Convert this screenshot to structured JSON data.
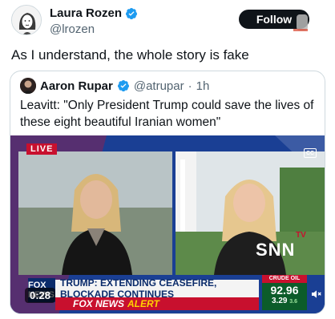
{
  "author": {
    "name": "Laura Rozen",
    "handle": "@lrozen"
  },
  "follow_label": "Follow",
  "tweet_text": "As I understand, the whole story is fake",
  "quote": {
    "name": "Aaron Rupar",
    "handle": "@atrupar",
    "separator": "·",
    "time": "1h",
    "text": "Leavitt: \"Only President Trump could save the lives of these eight beautiful Iranian women\""
  },
  "video": {
    "live_label": "LIVE",
    "cc_label": "CC",
    "watermark_tv": "TV",
    "watermark": "SNN",
    "network_logo": "FOX NEWS",
    "headline": "TRUMP: EXTENDING CEASEFIRE, BLOCKADE CONTINUES",
    "alert_network": "FOX NEWS",
    "alert_word": "ALERT",
    "crude_label": "CRUDE OIL",
    "crude_price": "92.96",
    "crude_change": "3.29",
    "crude_change_pct": "3.6",
    "elapsed": "0:28"
  },
  "colors": {
    "verified_blue": "#1d9bf0",
    "fox_red": "#c8102e",
    "fox_navy": "#0a2b6b",
    "oil_green": "#0c5c2a"
  },
  "icons": [
    "verified-badge-icon",
    "closed-captions-icon",
    "volume-icon"
  ]
}
